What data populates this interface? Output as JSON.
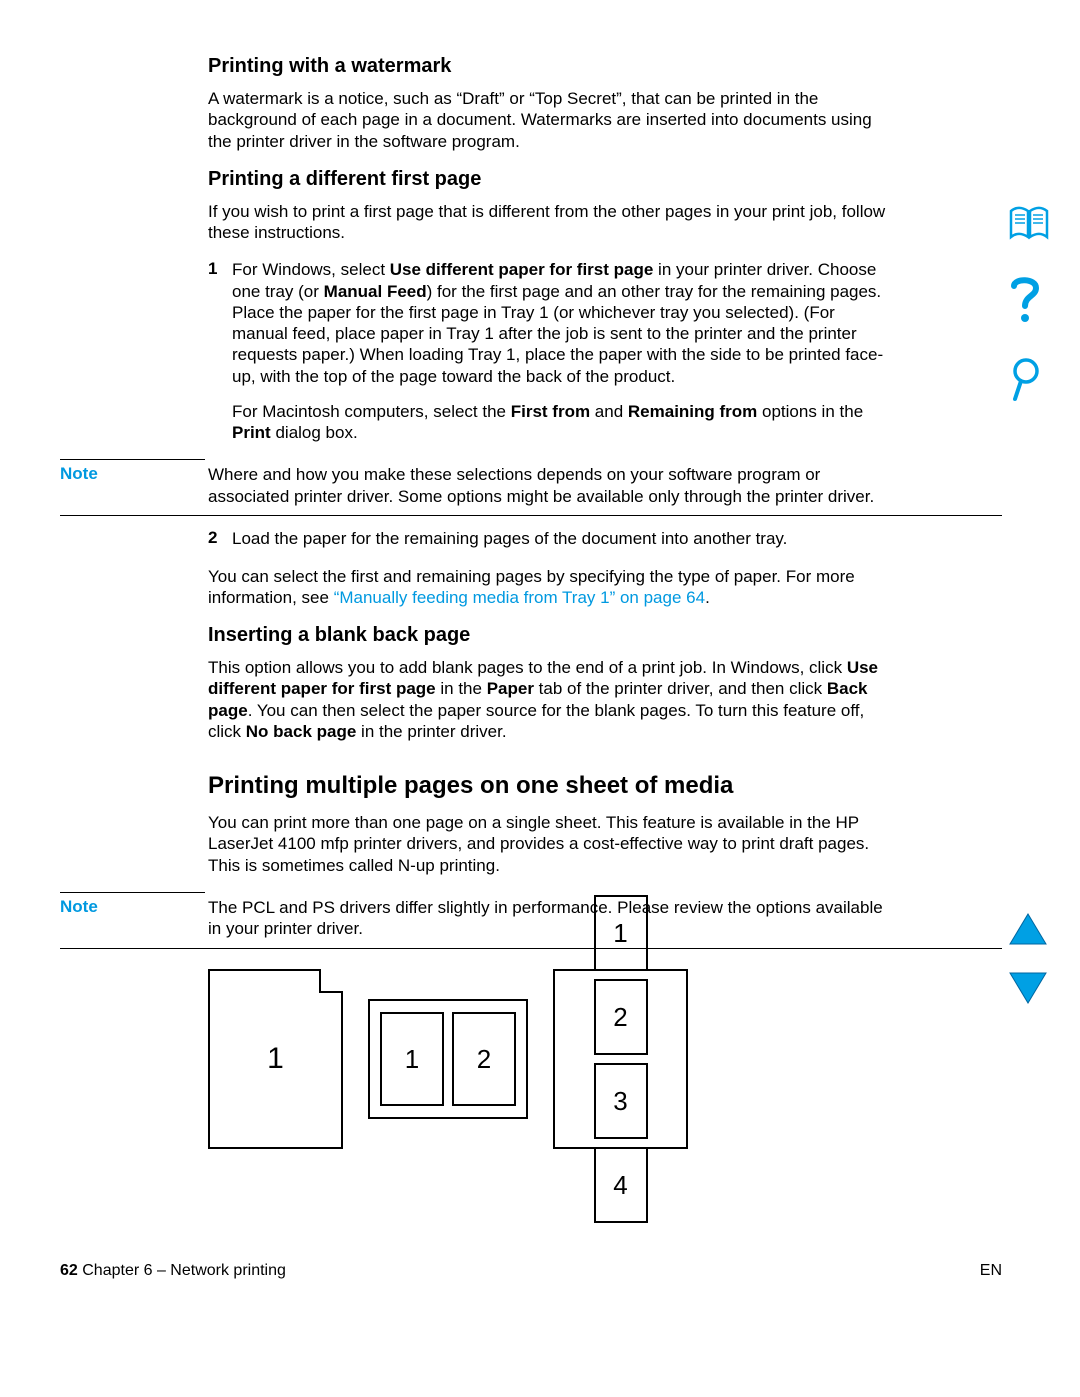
{
  "sections": {
    "watermark": {
      "heading": "Printing with a watermark",
      "body": "A watermark is a notice, such as “Draft” or “Top Secret”, that can be printed in the background of each page in a document. Watermarks are inserted into documents using the printer driver in the software program."
    },
    "firstpage": {
      "heading": "Printing a different first page",
      "intro": "If you wish to print a first page that is different from the other pages in your print job, follow these instructions.",
      "step1_a": "For Windows, select ",
      "step1_b_bold": "Use different paper for first page",
      "step1_c": " in your printer driver. Choose one tray (or ",
      "step1_d_bold": "Manual Feed",
      "step1_e": ") for the first page and an other tray for the remaining pages. Place the paper for the first page in Tray 1 (or whichever tray you selected). (For manual feed, place paper in Tray 1 after the job is sent to the printer and the printer requests paper.) When loading Tray 1, place the paper with the side to be printed face-up, with the top of the page toward the back of the product.",
      "step1_mac_a": "For Macintosh computers, select the ",
      "step1_mac_b": "First from",
      "step1_mac_c": " and ",
      "step1_mac_d": "Remaining from",
      "step1_mac_e": " options in the ",
      "step1_mac_f": "Print",
      "step1_mac_g": " dialog box.",
      "note_label": "Note",
      "note_body": "Where and how you make these selections depends on your software program or associated printer driver. Some options might be available only through the printer driver.",
      "step2": "Load the paper for the remaining pages of the document into another tray.",
      "after_a": "You can select the first and remaining pages by specifying the type of paper. For more information, see ",
      "after_link": "“Manually feeding media from Tray 1” on page 64",
      "after_b": "."
    },
    "blankback": {
      "heading": "Inserting a blank back page",
      "body_a": "This option allows you to add blank pages to the end of a print job. In Windows, click ",
      "body_b": "Use different paper for first page",
      "body_c": " in the ",
      "body_d": "Paper",
      "body_e": " tab of the printer driver, and then click ",
      "body_f": "Back page",
      "body_g": ". You can then select the paper source for the blank pages. To turn this feature off, click ",
      "body_h": "No back page",
      "body_i": " in the printer driver."
    },
    "nup": {
      "heading": "Printing multiple pages on one sheet of media",
      "body": "You can print more than one page on a single sheet. This feature is available in the HP LaserJet 4100 mfp printer drivers, and provides a cost-effective way to print draft pages. This is sometimes called N-up printing.",
      "note_label": "Note",
      "note_body": "The PCL and PS drivers differ slightly in performance. Please review the options available in your printer driver."
    }
  },
  "diagram": {
    "one": "1",
    "two_a": "1",
    "two_b": "2",
    "four_a": "1",
    "four_b": "2",
    "four_c": "3",
    "four_d": "4"
  },
  "footer": {
    "page": "62",
    "chapter": " Chapter 6 – Network printing",
    "lang": "EN"
  }
}
